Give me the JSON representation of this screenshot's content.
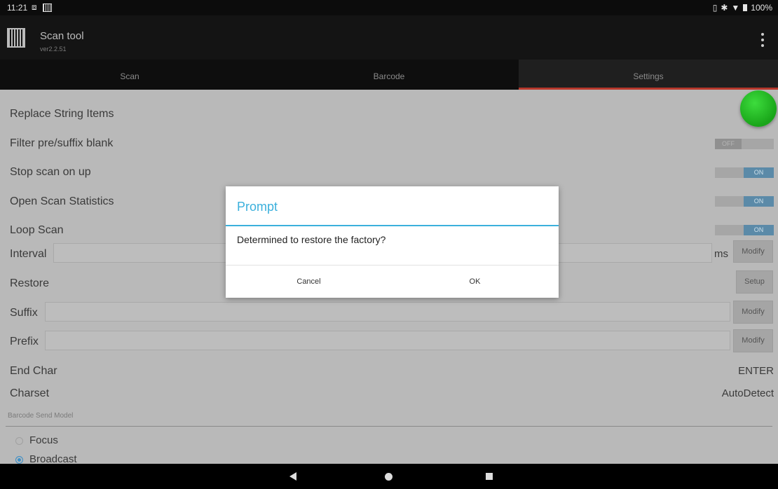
{
  "status": {
    "time": "11:21",
    "battery": "100%"
  },
  "app": {
    "title": "Scan tool",
    "version": "ver2.2.51"
  },
  "tabs": [
    {
      "label": "Scan"
    },
    {
      "label": "Barcode"
    },
    {
      "label": "Settings",
      "active": true
    }
  ],
  "settings": {
    "replace_string": "Replace String Items",
    "filter_blank": {
      "label": "Filter pre/suffix blank",
      "state": "OFF"
    },
    "stop_scan": {
      "label": "Stop scan on up",
      "state": "ON"
    },
    "scan_stats": {
      "label": "Open Scan Statistics",
      "state": "ON"
    },
    "loop_scan": {
      "label": "Loop Scan",
      "state": "ON"
    },
    "interval": {
      "label": "Interval",
      "value": "",
      "unit": "ms",
      "button": "Modify"
    },
    "restore": {
      "label": "Restore",
      "button": "Setup"
    },
    "suffix": {
      "label": "Suffix",
      "value": "",
      "button": "Modify"
    },
    "prefix": {
      "label": "Prefix",
      "value": "",
      "button": "Modify"
    },
    "end_char": {
      "label": "End Char",
      "value": "ENTER"
    },
    "charset": {
      "label": "Charset",
      "value": "AutoDetect"
    },
    "send_model": {
      "section": "Barcode Send Model",
      "options": [
        {
          "label": "Focus",
          "checked": false
        },
        {
          "label": "Broadcast",
          "checked": true
        }
      ]
    }
  },
  "dialog": {
    "title": "Prompt",
    "message": "Determined to restore the factory?",
    "cancel": "Cancel",
    "ok": "OK"
  },
  "colors": {
    "accent": "#3bb0dc",
    "tab_indicator": "#b7382c",
    "fab": "#22b522"
  }
}
